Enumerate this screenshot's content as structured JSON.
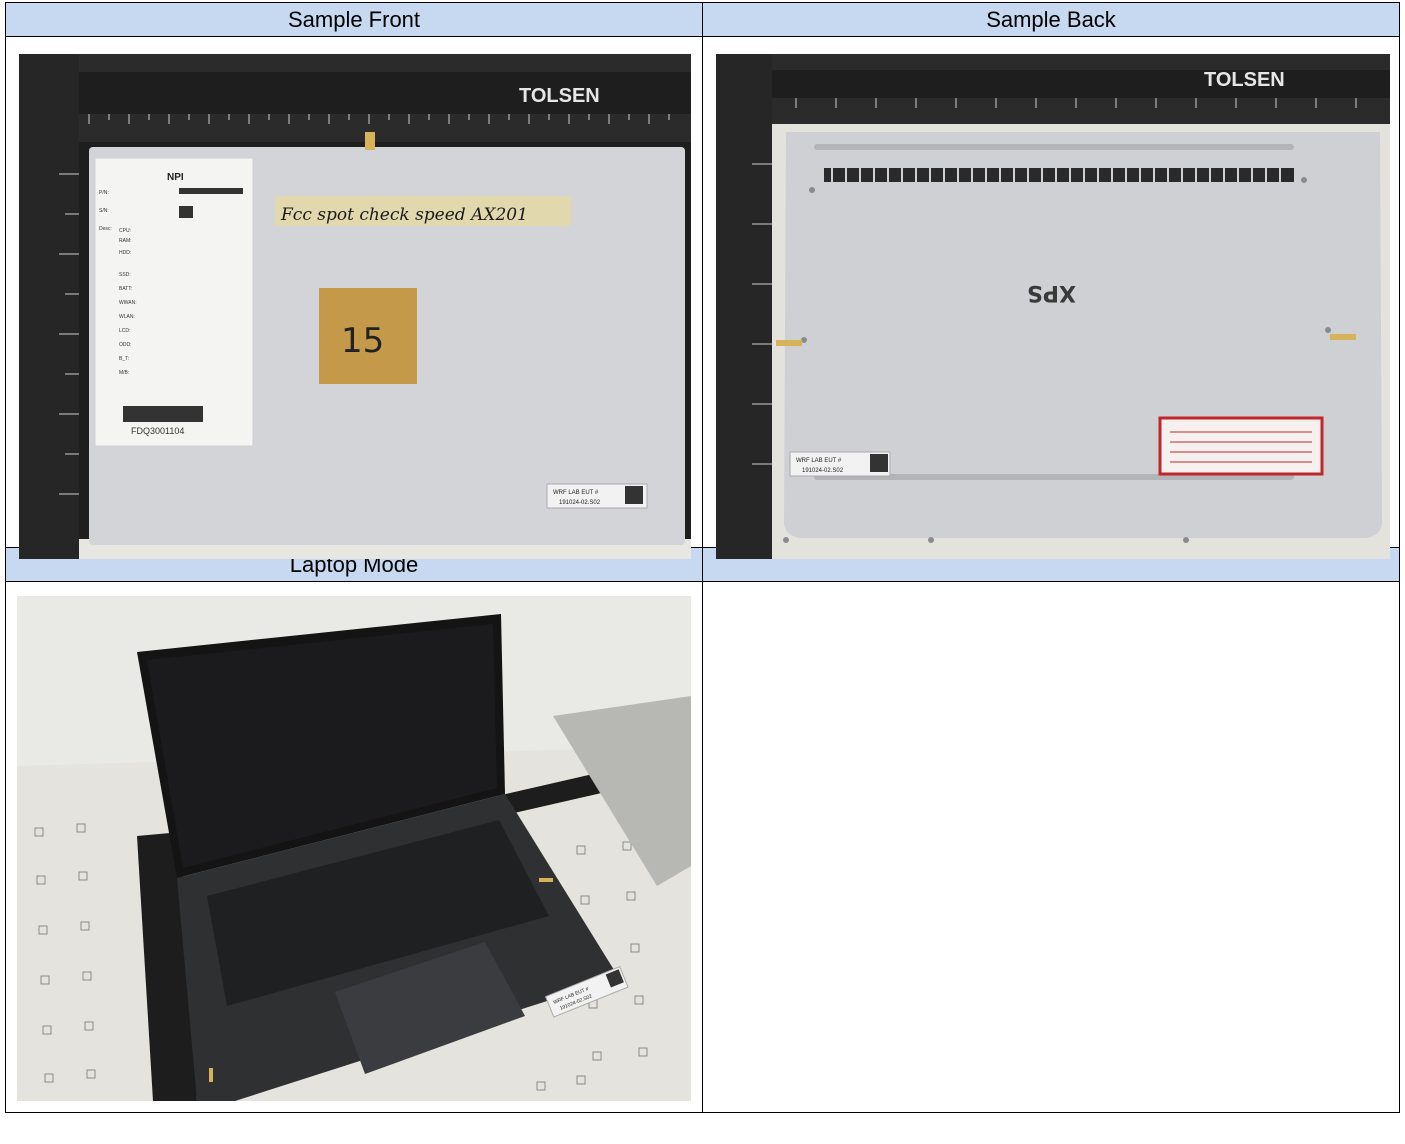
{
  "table": {
    "headers": [
      "Sample Front",
      "Sample Back",
      "Laptop Mode",
      ""
    ],
    "front_photo": {
      "ruler_brand": "TOLSEN",
      "label_title": "NPI",
      "label_fields": [
        "P/N:",
        "S/N:",
        "Desc:",
        "CPU:",
        "RAM:",
        "HDD:",
        "SSD:",
        "BATT:",
        "WWAN:",
        "WLAN:",
        "LCD:",
        "ODD:",
        "B_T:",
        "M/B:"
      ],
      "label_barcode_text": "FDQ3001104",
      "tape_note": "Fcc spot check   speed   AX201",
      "tag_number": "15",
      "intel_sticker_line1": "WRF LAB EUT #",
      "intel_sticker_line2": "191024-02.S02"
    },
    "back_photo": {
      "ruler_brand": "TOLSEN",
      "logo": "XPS",
      "intel_sticker_line1": "WRF LAB EUT #",
      "intel_sticker_line2": "191024-02.S02"
    },
    "laptop_photo": {
      "intel_sticker_line1": "WRF LAB EUT #",
      "intel_sticker_line2": "191024-02.S02"
    }
  }
}
